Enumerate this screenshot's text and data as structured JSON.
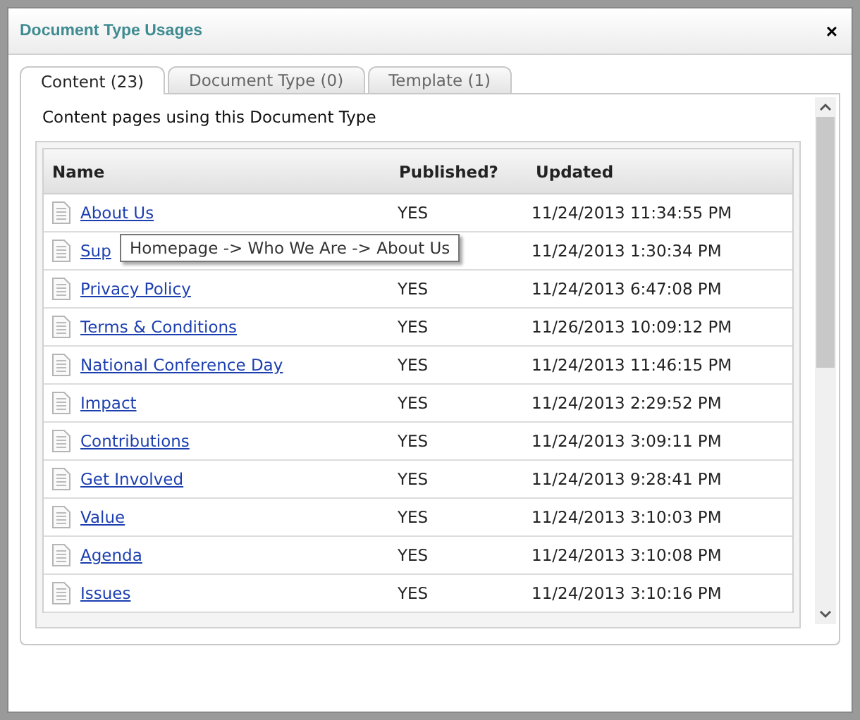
{
  "window": {
    "title": "Document Type Usages",
    "close": "×"
  },
  "tabs": [
    {
      "label": "Content (23)",
      "selected": true
    },
    {
      "label": "Document Type (0)",
      "selected": false
    },
    {
      "label": "Template (1)",
      "selected": false
    }
  ],
  "description": "Content pages using this Document Type",
  "table": {
    "columns": [
      "Name",
      "Published?",
      "Updated"
    ],
    "rows": [
      {
        "name": "About Us",
        "published": "YES",
        "updated": "11/24/2013 11:34:55 PM"
      },
      {
        "name": "Sup",
        "updated": "11/24/2013 1:30:34 PM"
      },
      {
        "name": "Privacy Policy",
        "published": "YES",
        "updated": "11/24/2013 6:47:08 PM"
      },
      {
        "name": "Terms & Conditions",
        "published": "YES",
        "updated": "11/26/2013 10:09:12 PM"
      },
      {
        "name": "National Conference Day",
        "published": "YES",
        "updated": "11/24/2013 11:46:15 PM"
      },
      {
        "name": "Impact",
        "published": "YES",
        "updated": "11/24/2013 2:29:52 PM"
      },
      {
        "name": "Contributions",
        "published": "YES",
        "updated": "11/24/2013 3:09:11 PM"
      },
      {
        "name": "Get Involved",
        "published": "YES",
        "updated": "11/24/2013 9:28:41 PM"
      },
      {
        "name": "Value",
        "published": "YES",
        "updated": "11/24/2013 3:10:03 PM"
      },
      {
        "name": "Agenda",
        "published": "YES",
        "updated": "11/24/2013 3:10:08 PM"
      },
      {
        "name": "Issues",
        "published": "YES",
        "updated": "11/24/2013 3:10:16 PM"
      }
    ]
  },
  "tooltip": "Homepage -> Who We Are -> About Us"
}
